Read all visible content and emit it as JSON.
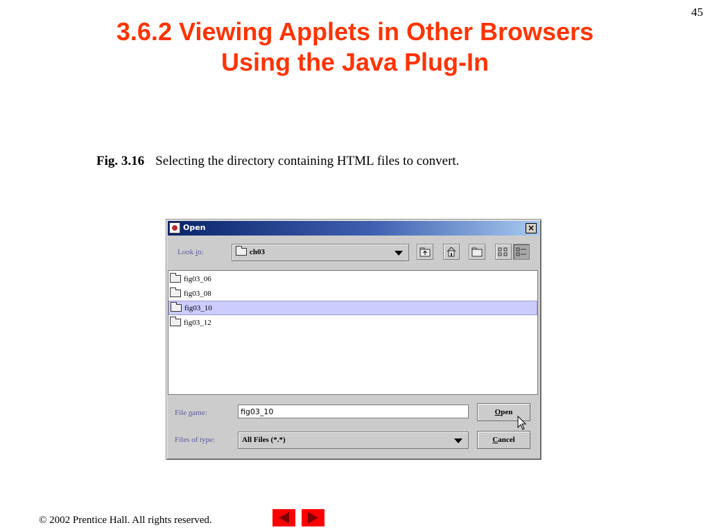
{
  "page_number": "45",
  "title_line1": "3.6.2  Viewing Applets in Other Browsers",
  "title_line2": "Using the Java Plug-In",
  "caption": {
    "label": "Fig. 3.16",
    "text": "Selecting the directory containing HTML files to convert."
  },
  "dialog": {
    "title": "Open",
    "close_glyph": "×",
    "look_in": {
      "label_pre": "Look ",
      "label_mnemonic": "i",
      "label_post": "n:",
      "value": "ch03"
    },
    "toolbar_icons": [
      "up-folder-icon",
      "home-icon",
      "new-folder-icon",
      "list-view-icon",
      "details-view-icon"
    ],
    "files": [
      "fig03_06",
      "fig03_08",
      "fig03_10",
      "fig03_12"
    ],
    "selected_file": "fig03_10",
    "file_name": {
      "label_pre": "File ",
      "label_mnemonic": "n",
      "label_post": "ame:",
      "value": "fig03_10"
    },
    "file_type": {
      "label": "Files of type:",
      "value": "All Files (*.*)"
    },
    "open_button": {
      "mnemonic": "O",
      "rest": "pen"
    },
    "cancel_button": {
      "mnemonic": "C",
      "rest": "ancel"
    }
  },
  "footer": {
    "copyright_symbol": "©",
    "text": " 2002 Prentice Hall.  All rights reserved."
  },
  "colors": {
    "title": "#ff3300",
    "nav_buttons": "#ff0000",
    "selection": "#ccccff"
  }
}
